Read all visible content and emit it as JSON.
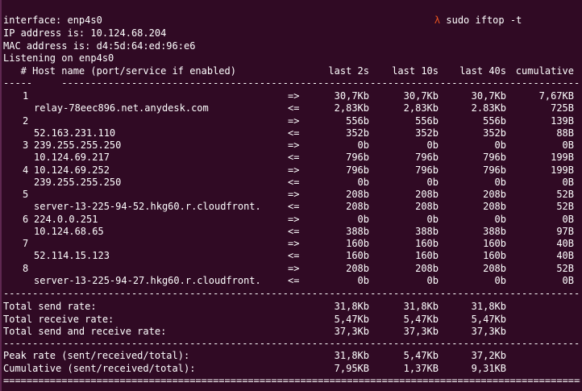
{
  "prompt": {
    "symbol": "λ",
    "command": "sudo iftop -t"
  },
  "info": {
    "interface": "interface: enp4s0",
    "ip": "IP address is: 10.124.68.204",
    "mac": "MAC address is: d4:5d:64:ed:96:e6",
    "listening": "Listening on enp4s0"
  },
  "header": {
    "title": "   # Host name (port/service if enabled)",
    "col1": "last 2s",
    "col2": "last 10s",
    "col3": "last 40s",
    "col4": "cumulative"
  },
  "header_dash_line": "-----     -----------------------------------------------------------------------------------------------",
  "separator_dash": "--------------------------------------------------------------------------------------------------------------",
  "separator_eq": "==============================================================================================================",
  "connections": [
    {
      "idx": "1",
      "host": "",
      "arrow": "=>",
      "v1": "30,7Kb",
      "v2": "30,7Kb",
      "v3": "30,7Kb",
      "v4": "7,67KB"
    },
    {
      "idx": "",
      "host": "relay-78eec896.net.anydesk.com",
      "arrow": "<=",
      "v1": "2,83Kb",
      "v2": "2,83Kb",
      "v3": "2.83Kb",
      "v4": "725B"
    },
    {
      "idx": "2",
      "host": "",
      "arrow": "=>",
      "v1": "556b",
      "v2": "556b",
      "v3": "556b",
      "v4": "139B"
    },
    {
      "idx": "",
      "host": "52.163.231.110",
      "arrow": "<=",
      "v1": "352b",
      "v2": "352b",
      "v3": "352b",
      "v4": "88B"
    },
    {
      "idx": "3",
      "host": "239.255.255.250",
      "arrow": "=>",
      "v1": "0b",
      "v2": "0b",
      "v3": "0b",
      "v4": "0B"
    },
    {
      "idx": "",
      "host": "10.124.69.217",
      "arrow": "<=",
      "v1": "796b",
      "v2": "796b",
      "v3": "796b",
      "v4": "199B"
    },
    {
      "idx": "4",
      "host": "10.124.69.252",
      "arrow": "=>",
      "v1": "796b",
      "v2": "796b",
      "v3": "796b",
      "v4": "199B"
    },
    {
      "idx": "",
      "host": "239.255.255.250",
      "arrow": "<=",
      "v1": "0b",
      "v2": "0b",
      "v3": "0b",
      "v4": "0B"
    },
    {
      "idx": "5",
      "host": "",
      "arrow": "=>",
      "v1": "208b",
      "v2": "208b",
      "v3": "208b",
      "v4": "52B"
    },
    {
      "idx": "",
      "host": "server-13-225-94-52.hkg60.r.cloudfront.",
      "arrow": "<=",
      "v1": "208b",
      "v2": "208b",
      "v3": "208b",
      "v4": "52B"
    },
    {
      "idx": "6",
      "host": "224.0.0.251",
      "arrow": "=>",
      "v1": "0b",
      "v2": "0b",
      "v3": "0b",
      "v4": "0B"
    },
    {
      "idx": "",
      "host": "10.124.68.65",
      "arrow": "<=",
      "v1": "388b",
      "v2": "388b",
      "v3": "388b",
      "v4": "97B"
    },
    {
      "idx": "7",
      "host": "",
      "arrow": "=>",
      "v1": "160b",
      "v2": "160b",
      "v3": "160b",
      "v4": "40B"
    },
    {
      "idx": "",
      "host": "52.114.15.123",
      "arrow": "<=",
      "v1": "160b",
      "v2": "160b",
      "v3": "160b",
      "v4": "40B"
    },
    {
      "idx": "8",
      "host": "",
      "arrow": "=>",
      "v1": "208b",
      "v2": "208b",
      "v3": "208b",
      "v4": "52B"
    },
    {
      "idx": "",
      "host": "server-13-225-94-27.hkg60.r.cloudfront.",
      "arrow": "<=",
      "v1": "0b",
      "v2": "0b",
      "v3": "0b",
      "v4": "0B"
    }
  ],
  "totals": [
    {
      "label": "Total send rate:",
      "v1": "31,8Kb",
      "v2": "31,8Kb",
      "v3": "31,8Kb"
    },
    {
      "label": "Total receive rate:",
      "v1": "5,47Kb",
      "v2": "5,47Kb",
      "v3": "5,47Kb"
    },
    {
      "label": "Total send and receive rate:",
      "v1": "37,3Kb",
      "v2": "37,3Kb",
      "v3": "37,3Kb"
    }
  ],
  "summary": [
    {
      "label": "Peak rate (sent/received/total):",
      "v1": "31,8Kb",
      "v2": "5,47Kb",
      "v3": "37,2Kb"
    },
    {
      "label": "Cumulative (sent/received/total):",
      "v1": "7,95KB",
      "v2": "1,37KB",
      "v3": "9,31KB"
    }
  ]
}
